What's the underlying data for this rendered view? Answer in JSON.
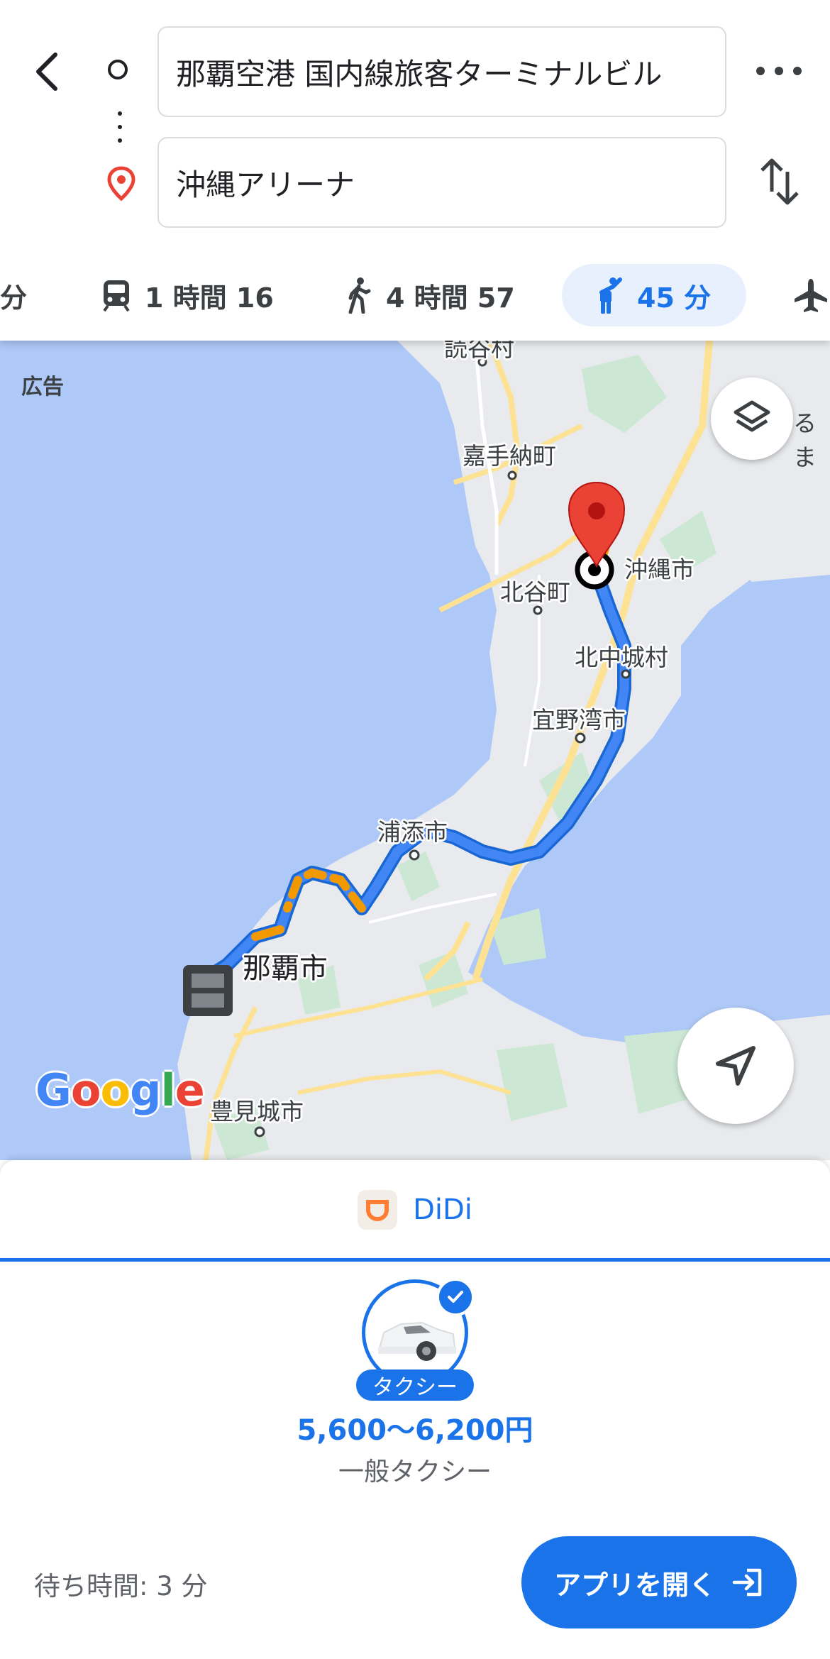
{
  "header": {
    "origin_value": "那覇空港 国内線旅客ターミナルビル",
    "destination_value": "沖縄アリーナ"
  },
  "modes": [
    {
      "label": "分",
      "icon": "car-icon"
    },
    {
      "label": "1 時間 16",
      "icon": "train-icon"
    },
    {
      "label": "4 時間 57",
      "icon": "walk-icon"
    },
    {
      "label": "45 分",
      "icon": "ride-hail-icon",
      "active": true
    },
    {
      "label": "",
      "icon": "flight-icon"
    }
  ],
  "map": {
    "ad_label": "広告",
    "logo_text": "Google",
    "edge_label": "るま",
    "places": {
      "yomitan": "読谷村",
      "kadena": "嘉手納町",
      "chatan": "北谷町",
      "okinawa_city": "沖縄市",
      "kitanakagusuku": "北中城村",
      "ginowan": "宜野湾市",
      "urasoe": "浦添市",
      "naha": "那覇市",
      "tomigusuku": "豊見城市"
    }
  },
  "sheet": {
    "provider": "DiDi",
    "taxi_chip": "タクシー",
    "price": "5,600〜6,200円",
    "subtitle": "一般タクシー",
    "wait": "待ち時間: 3 分",
    "open_app_label": "アプリを開く"
  },
  "colors": {
    "accent": "#1a73e8",
    "route": "#4285f4",
    "traffic": "#f29900",
    "pin": "#ea4335",
    "water": "#aec8f7",
    "land": "#e8eaed"
  }
}
